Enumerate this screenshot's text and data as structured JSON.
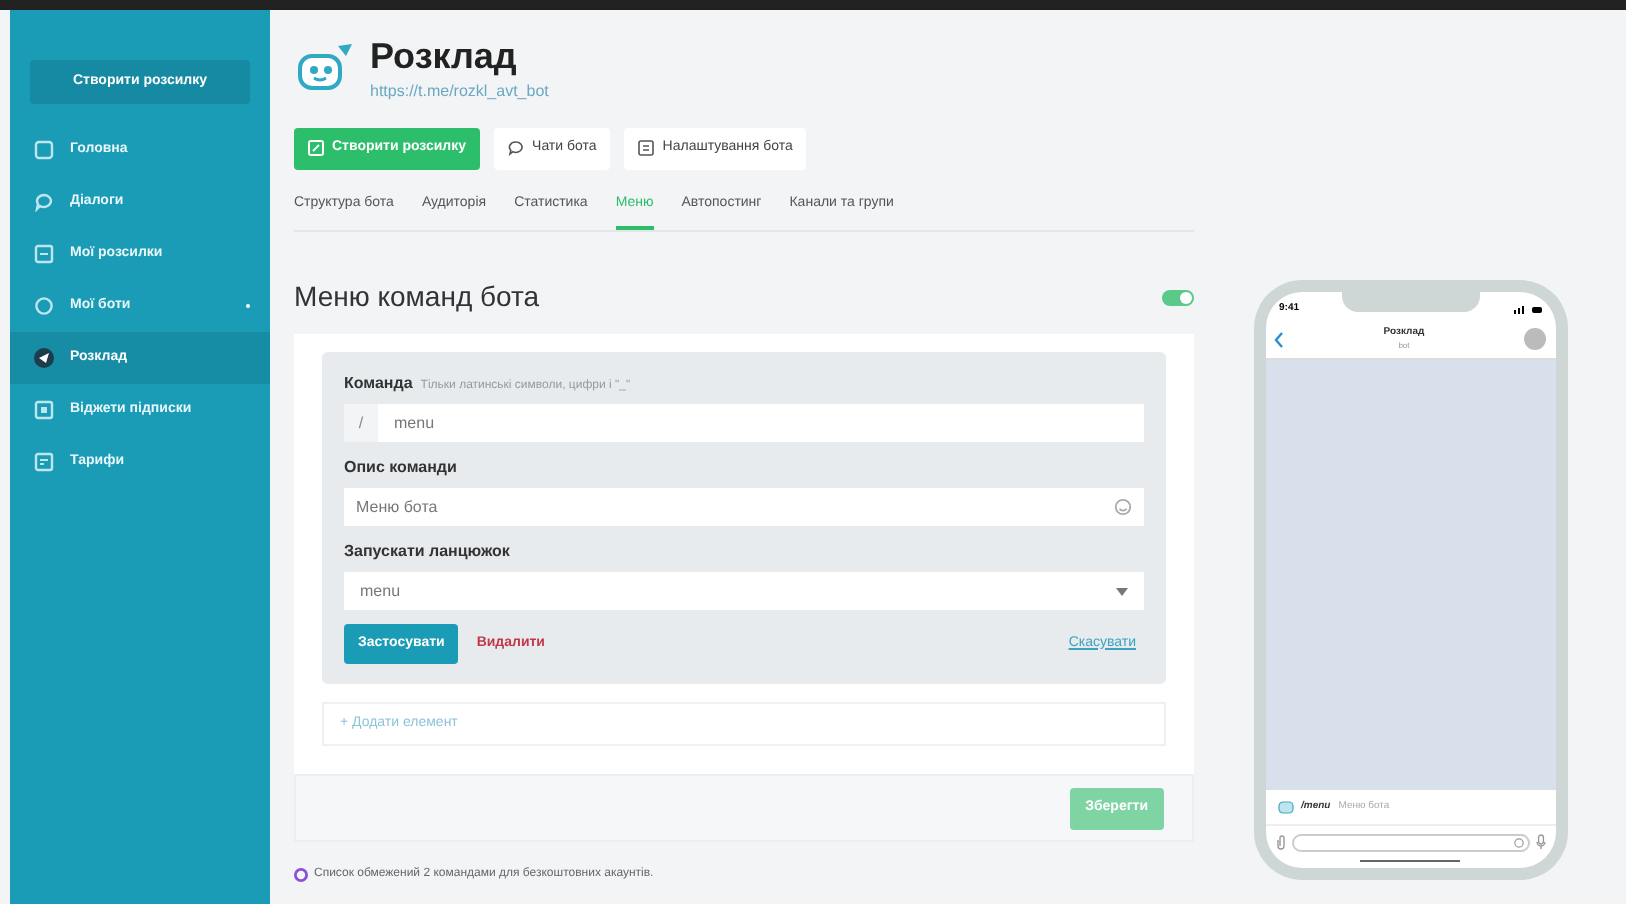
{
  "sidebar": {
    "create_button": "Створити розсилку",
    "items": [
      {
        "label": "Головна",
        "selected": false
      },
      {
        "label": "Діалоги",
        "selected": false
      },
      {
        "label": "Мої розсилки",
        "selected": false
      },
      {
        "label": "Мої боти",
        "selected": false,
        "has_submenu": true
      },
      {
        "label": "Розклад",
        "selected": true
      },
      {
        "label": "Віджети підписки",
        "selected": false
      },
      {
        "label": "Тарифи",
        "selected": false
      }
    ]
  },
  "bot": {
    "title": "Розклад",
    "link": "https://t.me/rozkl_avt_bot"
  },
  "actions": [
    {
      "label": "Створити розсилку",
      "kind": "primary"
    },
    {
      "label": "Чати бота",
      "kind": "chat"
    },
    {
      "label": "Налаштування бота",
      "kind": "settings"
    }
  ],
  "tabs": [
    {
      "label": "Структура бота",
      "selected": false
    },
    {
      "label": "Аудиторія",
      "selected": false
    },
    {
      "label": "Статистика",
      "selected": false
    },
    {
      "label": "Меню",
      "selected": true
    },
    {
      "label": "Автопостинг",
      "selected": false
    },
    {
      "label": "Канали та групи",
      "selected": false
    }
  ],
  "section": {
    "title": "Меню команд бота",
    "toggle_on": true
  },
  "form": {
    "command_label": "Команда",
    "command_hint": "Тільки латинські символи, цифри і \"_\"",
    "prefix": "/",
    "command_value": "menu",
    "description_label": "Опис команди",
    "description_value": "Меню бота",
    "chain_label": "Запускати ланцюжок",
    "chain_value": "menu",
    "apply": "Застосувати",
    "delete": "Видалити",
    "cancel": "Скасувати"
  },
  "add_element": "+ Додати елемент",
  "save": {
    "label": "Зберегти",
    "disabled": true
  },
  "note": "Список обмежений 2 командами для безкоштовних акаунтів.",
  "phone": {
    "time": "9:41",
    "chat_title": "Розклад",
    "chat_subtitle": "bot",
    "command": "/menu",
    "command_description": "Меню бота"
  }
}
